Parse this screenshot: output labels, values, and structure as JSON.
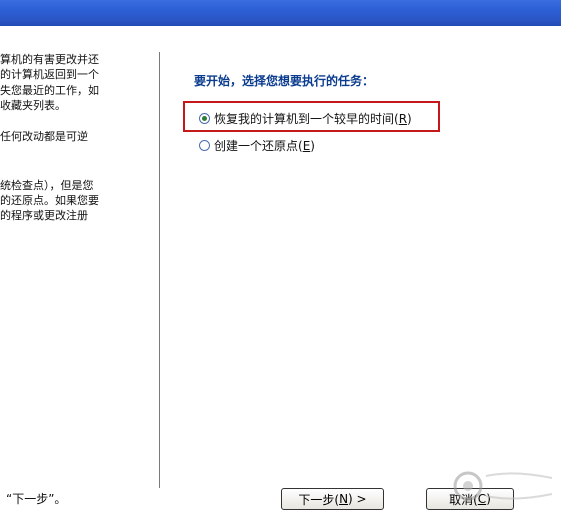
{
  "left_panel": {
    "lines": [
      "算机的有害更改并还",
      "的计算机返回到一个",
      "失您最近的工作，如",
      "收藏夹列表。",
      "任何改动都是可逆",
      "统检查点），但是您",
      "的还原点。如果您要",
      "的程序或更改注册"
    ],
    "footer_hint": "“下一步”。"
  },
  "main": {
    "heading": "要开始，选择您想要执行的任务：",
    "options": [
      {
        "label": "恢复我的计算机到一个较早的时间(",
        "key": "R",
        "suffix": ")",
        "selected": true
      },
      {
        "label": "创建一个还原点(",
        "key": "E",
        "suffix": ")",
        "selected": false
      }
    ]
  },
  "buttons": {
    "next": {
      "label": "下一步(",
      "key": "N",
      "suffix": ") >"
    },
    "cancel": {
      "label": "取消(",
      "key": "C",
      "suffix": ")"
    }
  },
  "colors": {
    "titlebar": "#2b58c8",
    "highlight_border": "#c4191b",
    "heading": "#0b3c8f"
  }
}
